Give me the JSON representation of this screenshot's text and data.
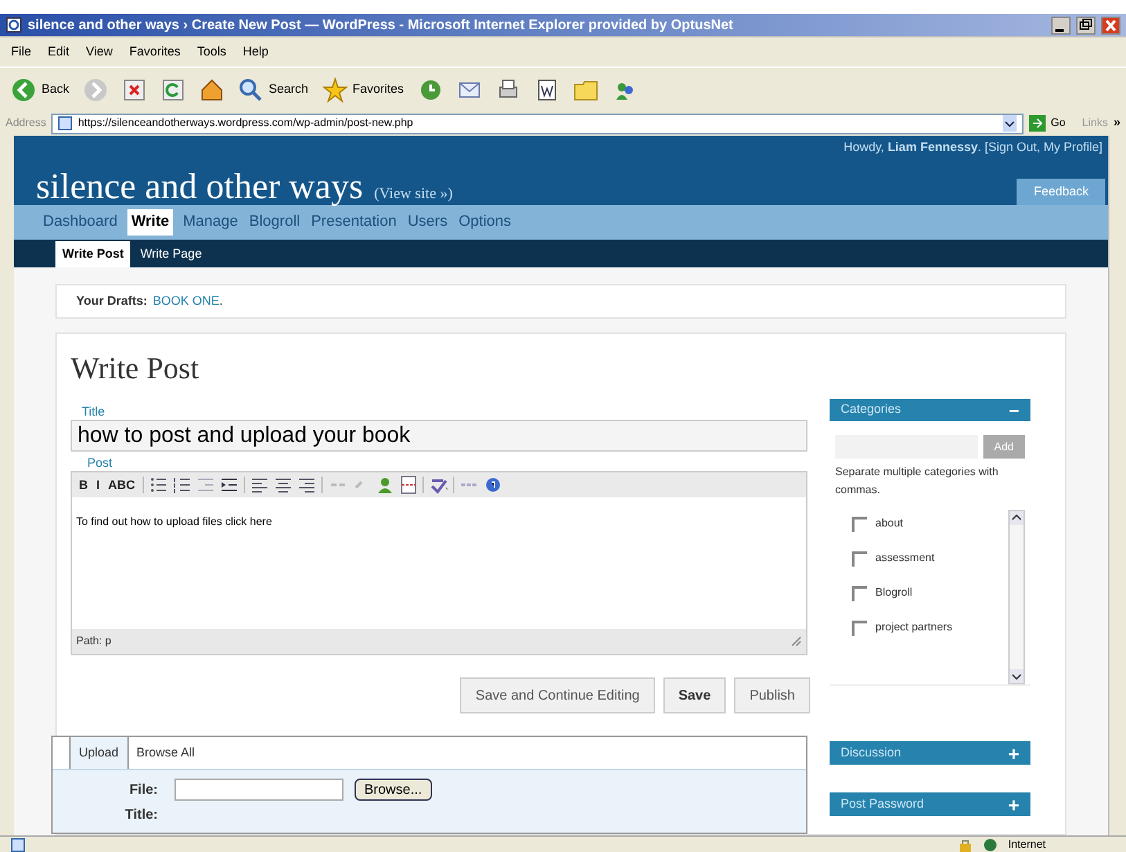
{
  "window": {
    "title": "silence and other ways › Create New Post — WordPress - Microsoft Internet Explorer provided by OptusNet"
  },
  "menu": [
    "File",
    "Edit",
    "View",
    "Favorites",
    "Tools",
    "Help"
  ],
  "toolbar": [
    {
      "kind": "back",
      "label": "Back"
    },
    {
      "kind": "forward"
    },
    {
      "kind": "stop"
    },
    {
      "kind": "refresh"
    },
    {
      "kind": "home"
    },
    {
      "kind": "search",
      "label": "Search"
    },
    {
      "kind": "favorites",
      "label": "Favorites"
    },
    {
      "kind": "history"
    },
    {
      "kind": "mail"
    },
    {
      "kind": "print"
    },
    {
      "kind": "word"
    },
    {
      "kind": "folder"
    },
    {
      "kind": "messenger"
    }
  ],
  "address": {
    "label": "Address",
    "url": "https://silenceandotherways.wordpress.com/wp-admin/post-new.php",
    "go": "Go",
    "links": "Links",
    "more": "»"
  },
  "header": {
    "site": "silence and other ways",
    "view_site": "(View site »)",
    "howdy": "Howdy, **Liam Fennessy**. [Sign Out, My Profile]",
    "feedback": "Feedback"
  },
  "nav": [
    {
      "label": "Dashboard",
      "selected": false
    },
    {
      "label": "Write",
      "selected": true
    },
    {
      "label": "Manage",
      "selected": false
    },
    {
      "label": "Blogroll",
      "selected": false
    },
    {
      "label": "Presentation",
      "selected": false
    },
    {
      "label": "Users",
      "selected": false
    },
    {
      "label": "Options",
      "selected": false
    }
  ],
  "subnav": [
    {
      "label": "Write Post",
      "selected": true
    },
    {
      "label": "Write Page",
      "selected": false
    }
  ],
  "drafts": {
    "label": "Your Drafts:",
    "link": "BOOK ONE",
    "end": "."
  },
  "heading": "Write Post",
  "title_field": {
    "label": "Title",
    "value": "how to post and upload your book"
  },
  "post": {
    "label": "Post",
    "tools": [
      {
        "kind": "text",
        "label": "B"
      },
      {
        "kind": "text",
        "label": "I"
      },
      {
        "kind": "text",
        "label": "ABC"
      },
      {
        "kind": "sep"
      },
      {
        "kind": "bullets"
      },
      {
        "kind": "numbers"
      },
      {
        "kind": "outdent"
      },
      {
        "kind": "indent"
      },
      {
        "kind": "sep"
      },
      {
        "kind": "align-left"
      },
      {
        "kind": "align-center"
      },
      {
        "kind": "align-right"
      },
      {
        "kind": "sep"
      },
      {
        "kind": "link"
      },
      {
        "kind": "unlink"
      },
      {
        "kind": "image"
      },
      {
        "kind": "more"
      },
      {
        "kind": "sep"
      },
      {
        "kind": "spell"
      },
      {
        "kind": "sep"
      },
      {
        "kind": "toggle"
      },
      {
        "kind": "help"
      }
    ],
    "content": "To find out how to upload files click here",
    "path": "Path: p"
  },
  "buttons": [
    {
      "label": "Save and Continue Editing",
      "primary": false
    },
    {
      "label": "Save",
      "primary": true
    },
    {
      "label": "Publish",
      "primary": false
    }
  ],
  "upload": {
    "tabs": [
      {
        "label": "Upload",
        "selected": true
      },
      {
        "label": "Browse All",
        "selected": false
      }
    ],
    "file_label": "File:",
    "browse": "Browse...",
    "title_label": "Title:"
  },
  "sidebar": {
    "categories": {
      "title": "Categories",
      "toggle": "−",
      "add": "Add",
      "hint": "Separate multiple categories with commas.",
      "items": [
        {
          "label": "about",
          "checked": false
        },
        {
          "label": "assessment",
          "checked": false
        },
        {
          "label": "Blogroll",
          "checked": false
        },
        {
          "label": "project partners",
          "checked": false
        }
      ]
    },
    "panels": [
      {
        "title": "Discussion",
        "toggle": "+"
      },
      {
        "title": "Post Password",
        "toggle": "+"
      }
    ]
  },
  "status_bar": {
    "zone": "Internet"
  }
}
